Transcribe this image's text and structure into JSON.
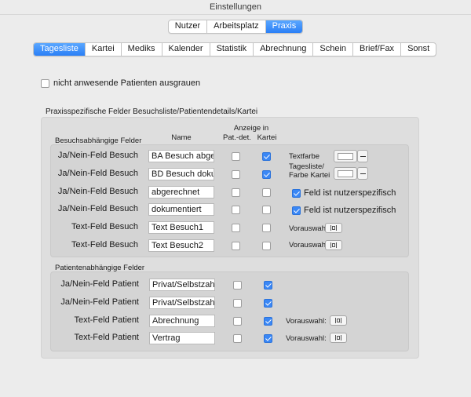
{
  "window": {
    "title": "Einstellungen"
  },
  "top_segments": [
    {
      "label": "Nutzer",
      "active": false
    },
    {
      "label": "Arbeitsplatz",
      "active": false
    },
    {
      "label": "Praxis",
      "active": true
    }
  ],
  "tabs": [
    {
      "label": "Tagesliste",
      "active": true
    },
    {
      "label": "Kartei",
      "active": false
    },
    {
      "label": "Mediks",
      "active": false
    },
    {
      "label": "Kalender",
      "active": false
    },
    {
      "label": "Statistik",
      "active": false
    },
    {
      "label": "Abrechnung",
      "active": false
    },
    {
      "label": "Schein",
      "active": false
    },
    {
      "label": "Brief/Fax",
      "active": false
    },
    {
      "label": "Sonst",
      "active": false
    }
  ],
  "grey_out": {
    "label": "nicht anwesende Patienten ausgrauen",
    "checked": false
  },
  "section_title": "Praxisspezifische Felder Besuchsliste/Patientendetails/Kartei",
  "headers": {
    "name": "Name",
    "anzeige": "Anzeige in",
    "pat_det": "Pat.-det.",
    "kartei": "Kartei"
  },
  "visit_group": {
    "title": "Besuchsabhängige Felder",
    "rows": [
      {
        "label": "Ja/Nein-Feld Besuch",
        "value": "BA Besuch abger",
        "pat_det": false,
        "kartei": true
      },
      {
        "label": "Ja/Nein-Feld Besuch",
        "value": "BD Besuch dokum",
        "pat_det": false,
        "kartei": true
      },
      {
        "label": "Ja/Nein-Feld Besuch",
        "value": "abgerechnet",
        "pat_det": false,
        "kartei": false
      },
      {
        "label": "Ja/Nein-Feld Besuch",
        "value": "dokumentiert",
        "pat_det": false,
        "kartei": false
      },
      {
        "label": "Text-Feld Besuch",
        "value": "Text Besuch1",
        "pat_det": false,
        "kartei": false
      },
      {
        "label": "Text-Feld Besuch",
        "value": "Text Besuch2",
        "pat_det": false,
        "kartei": false
      }
    ],
    "textfarbe_label": "Textfarbe",
    "farbe_label_1": "Tagesliste/",
    "farbe_label_2": "Farbe Kartei",
    "user_specific": [
      {
        "label": "Feld ist nutzerspezifisch",
        "checked": true
      },
      {
        "label": "Feld ist nutzerspezifisch",
        "checked": true
      }
    ],
    "preselect_label": "Vorauswahl:"
  },
  "patient_group": {
    "title": "Patientenabhängige Felder",
    "rows": [
      {
        "label": "Ja/Nein-Feld Patient",
        "value": "Privat/Selbstzahl",
        "pat_det": false,
        "kartei": true
      },
      {
        "label": "Ja/Nein-Feld Patient",
        "value": "Privat/Selbstzahl",
        "pat_det": false,
        "kartei": true
      },
      {
        "label": "Text-Feld Patient",
        "value": "Abrechnung",
        "pat_det": false,
        "kartei": true
      },
      {
        "label": "Text-Feld Patient",
        "value": "Vertrag",
        "pat_det": false,
        "kartei": true
      }
    ],
    "preselect_label": "Vorauswahl:"
  },
  "icons": {
    "check": "checkmark-icon",
    "preselect": "list-picker-icon",
    "remove": "minus-icon"
  },
  "colors": {
    "accent": "#3a87f5",
    "window_bg": "#ececec",
    "group_bg": "#dedede",
    "inner_bg": "#d4d4d4"
  }
}
